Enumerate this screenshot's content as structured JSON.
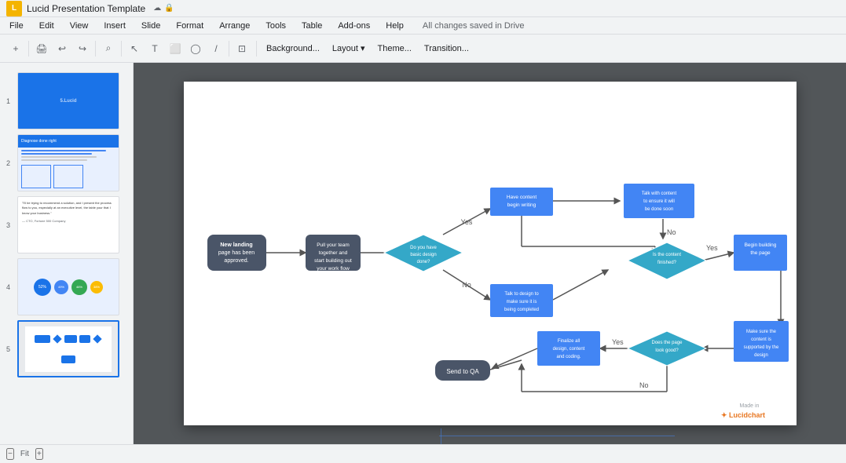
{
  "titleBar": {
    "logo": "L",
    "title": "Lucid Presentation Template",
    "cloudIcon": "☁",
    "lockIcon": "🔒"
  },
  "menuBar": {
    "items": [
      "File",
      "Edit",
      "View",
      "Insert",
      "Slide",
      "Format",
      "Arrange",
      "Tools",
      "Table",
      "Add-ons",
      "Help"
    ],
    "autosave": "All changes saved in Drive"
  },
  "toolbar": {
    "buttons": [
      "+",
      "−",
      "⟲",
      "⟳"
    ],
    "dropdowns": [
      "Background...",
      "Layout ▾",
      "Theme...",
      "Transition..."
    ]
  },
  "slides": [
    {
      "num": "1",
      "active": false
    },
    {
      "num": "2",
      "active": false
    },
    {
      "num": "3",
      "active": false
    },
    {
      "num": "4",
      "active": false
    },
    {
      "num": "5",
      "active": true
    }
  ],
  "flowchart": {
    "nodes": {
      "newLanding": "New landing page has been approved.",
      "pullTeam": "Pull your team together and start building out your work flow",
      "doYouHave": "Do you have basic design done?",
      "haveContent": "Have content begin writing",
      "talkWithContent": "Talk with content to ensure it will be done soon",
      "talkToDesign": "Talk to design to make sure it is being completed",
      "isContentFinished": "Is the content finished?",
      "beginBuilding": "Begin building the page",
      "makeSureContent": "Make sure the content is supported by the design",
      "doesPageLook": "Does the page look good?",
      "finalizeAll": "Finalize all design, content and coding.",
      "sendToQA": "Send to QA"
    },
    "edges": {
      "yes1": "Yes",
      "no1": "No",
      "yes2": "Yes",
      "no2": "No",
      "yes3": "Yes",
      "no3": "No"
    },
    "brand": {
      "madeIn": "Made in",
      "logoText": "Lucidchart"
    }
  },
  "bottomBar": {
    "zoomIn": "+",
    "zoomOut": "−",
    "zoomLevel": "Fit"
  }
}
